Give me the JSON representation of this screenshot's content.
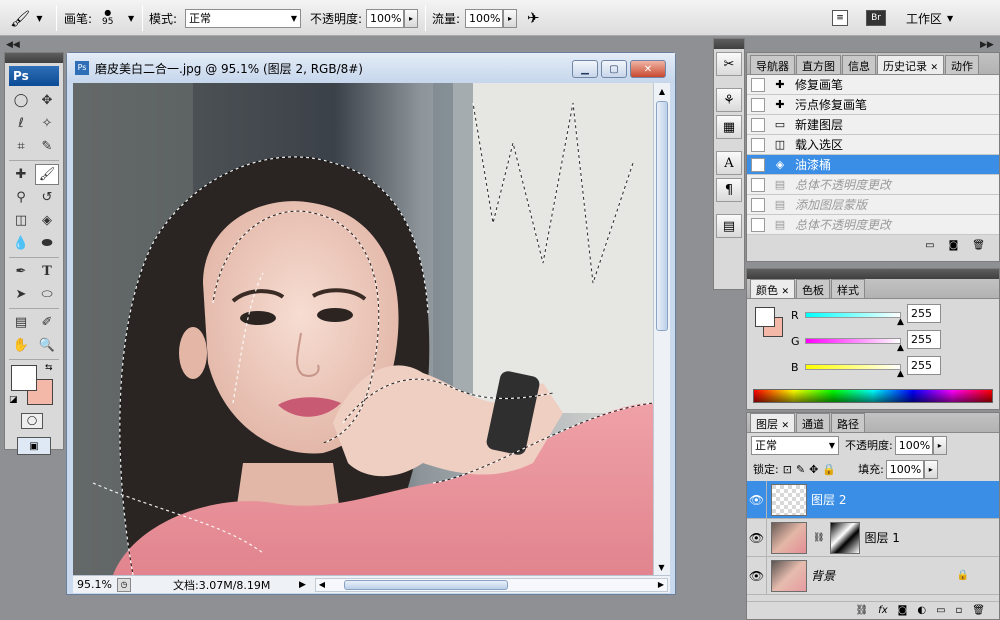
{
  "options_bar": {
    "brush_label": "画笔:",
    "brush_size": "95",
    "mode_label": "模式:",
    "mode_value": "正常",
    "opacity_label": "不透明度:",
    "opacity_value": "100%",
    "flow_label": "流量:",
    "flow_value": "100%",
    "workspace_label": "工作区"
  },
  "toolbox": {
    "logo": "Ps"
  },
  "document": {
    "title": "磨皮美白二合一.jpg @ 95.1% (图层 2, RGB/8#)",
    "zoom": "95.1%",
    "doc_info": "文档:3.07M/8.19M"
  },
  "history_panel": {
    "tabs": [
      "导航器",
      "直方图",
      "信息",
      "历史记录",
      "动作"
    ],
    "active_tab": "历史记录",
    "items": [
      {
        "label": "修复画笔",
        "icon": "healing-brush-icon",
        "state": "normal"
      },
      {
        "label": "污点修复画笔",
        "icon": "spot-healing-icon",
        "state": "normal"
      },
      {
        "label": "新建图层",
        "icon": "new-layer-icon",
        "state": "normal"
      },
      {
        "label": "载入选区",
        "icon": "load-selection-icon",
        "state": "normal"
      },
      {
        "label": "油漆桶",
        "icon": "paint-bucket-icon",
        "state": "selected"
      },
      {
        "label": "总体不透明度更改",
        "icon": "step-icon",
        "state": "dimmed"
      },
      {
        "label": "添加图层蒙版",
        "icon": "step-icon",
        "state": "dimmed"
      },
      {
        "label": "总体不透明度更改",
        "icon": "step-icon",
        "state": "dimmed"
      }
    ]
  },
  "color_panel": {
    "tabs": [
      "颜色",
      "色板",
      "样式"
    ],
    "r_label": "R",
    "r_value": "255",
    "g_label": "G",
    "g_value": "255",
    "b_label": "B",
    "b_value": "255"
  },
  "layers_panel": {
    "tabs": [
      "图层",
      "通道",
      "路径"
    ],
    "blend_mode": "正常",
    "opacity_label": "不透明度:",
    "opacity_value": "100%",
    "lock_label": "锁定:",
    "fill_label": "填充:",
    "fill_value": "100%",
    "layers": [
      {
        "name": "图层 2",
        "selected": true
      },
      {
        "name": "图层 1",
        "selected": false
      },
      {
        "name": "背景",
        "selected": false
      }
    ]
  },
  "colors": {
    "foreground": "#ffffff",
    "background": "#f4b8a8",
    "selection_blue": "#3a8ee6"
  }
}
